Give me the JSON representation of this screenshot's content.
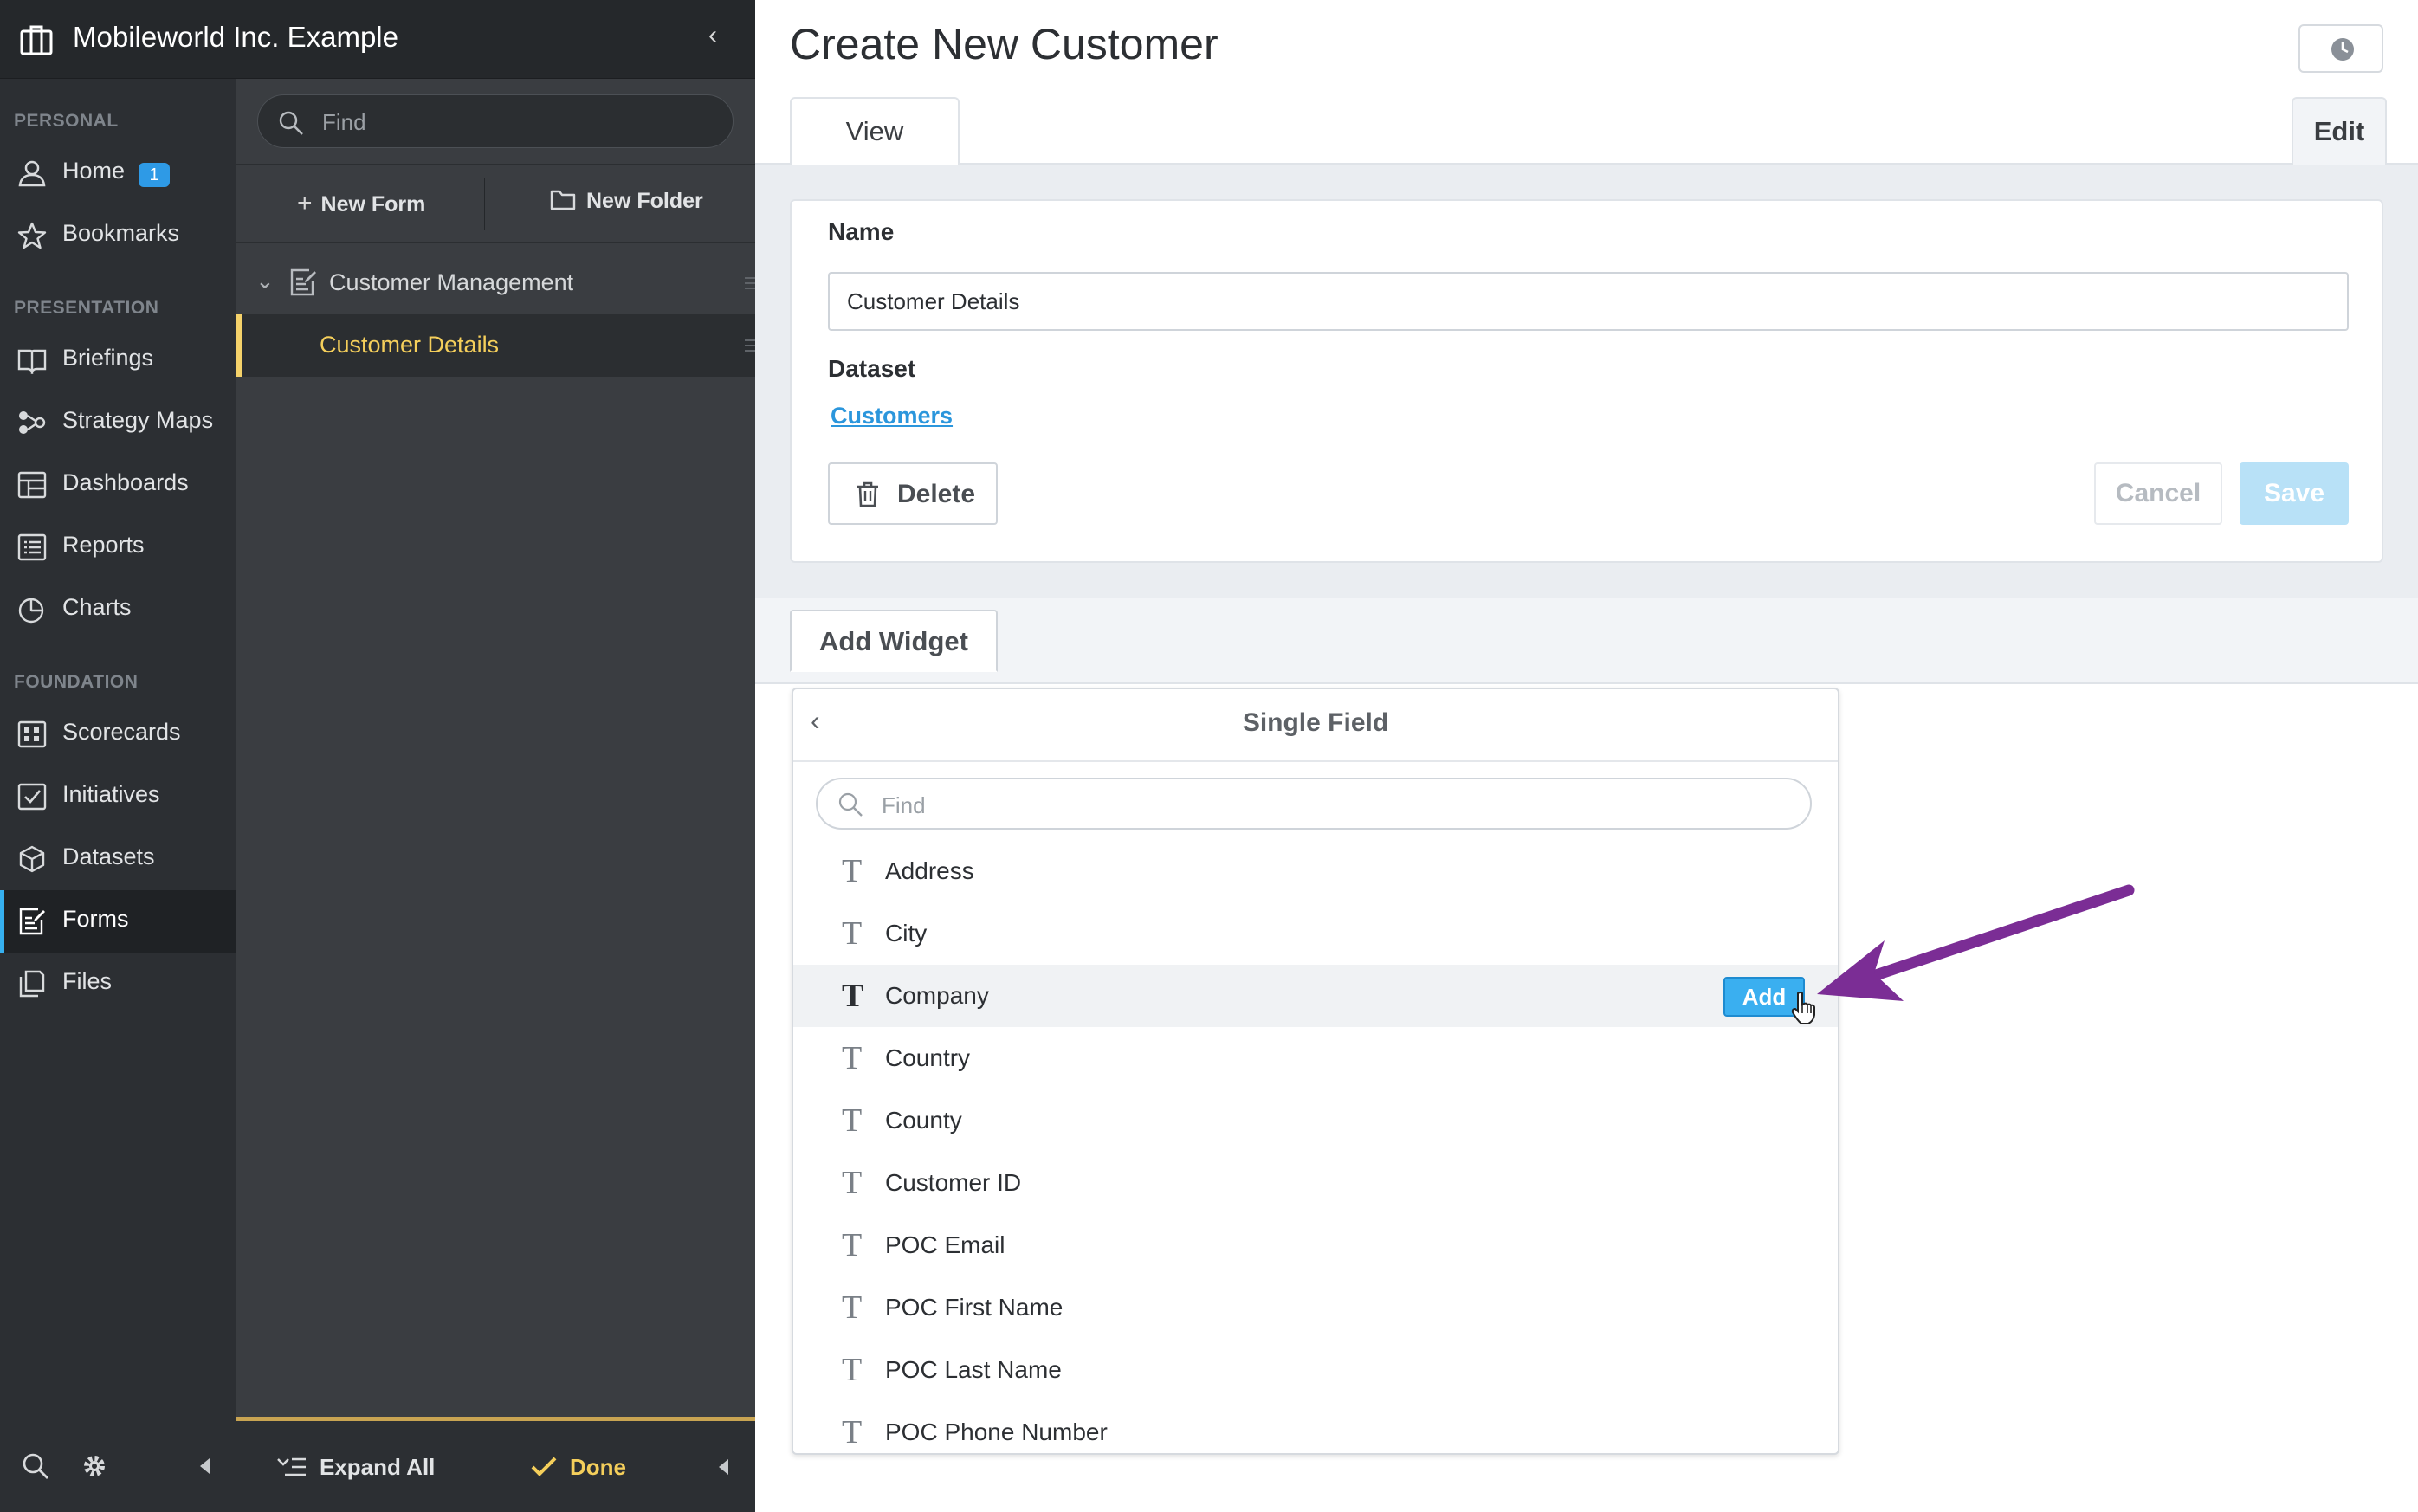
{
  "org": {
    "name": "Mobileworld Inc. Example"
  },
  "nav": {
    "sections": {
      "personal": "PERSONAL",
      "presentation": "PRESENTATION",
      "foundation": "FOUNDATION"
    },
    "items": [
      {
        "label": "Home",
        "icon": "user-icon",
        "badge": "1"
      },
      {
        "label": "Bookmarks",
        "icon": "star-icon"
      },
      {
        "label": "Briefings",
        "icon": "book-icon"
      },
      {
        "label": "Strategy Maps",
        "icon": "strategy-map-icon"
      },
      {
        "label": "Dashboards",
        "icon": "dashboard-icon"
      },
      {
        "label": "Reports",
        "icon": "report-icon"
      },
      {
        "label": "Charts",
        "icon": "pie-chart-icon"
      },
      {
        "label": "Scorecards",
        "icon": "scorecard-icon"
      },
      {
        "label": "Initiatives",
        "icon": "checkbox-icon"
      },
      {
        "label": "Datasets",
        "icon": "cube-icon"
      },
      {
        "label": "Forms",
        "icon": "form-icon",
        "active": true
      },
      {
        "label": "Files",
        "icon": "files-icon"
      }
    ]
  },
  "panel": {
    "search_placeholder": "Find",
    "new_form": "New Form",
    "new_folder": "New Folder",
    "folder": "Customer Management",
    "selected_item": "Customer Details",
    "expand_all": "Expand All",
    "done": "Done"
  },
  "main": {
    "title": "Create New Customer",
    "tabs": {
      "view": "View",
      "edit": "Edit"
    },
    "name_label": "Name",
    "name_value": "Customer Details",
    "dataset_label": "Dataset",
    "dataset_value": "Customers",
    "delete": "Delete",
    "cancel": "Cancel",
    "save": "Save",
    "add_widget": "Add Widget"
  },
  "dropdown": {
    "title": "Single Field",
    "search_placeholder": "Find",
    "field_glyph": "T",
    "add_label": "Add",
    "items": [
      "Address",
      "City",
      "Company",
      "Country",
      "County",
      "Customer ID",
      "POC Email",
      "POC First Name",
      "POC Last Name",
      "POC Phone Number"
    ],
    "hovered": "Company"
  },
  "colors": {
    "accent": "#36b0ef",
    "highlight": "#f5cf5b",
    "arrow": "#7b2d95"
  }
}
